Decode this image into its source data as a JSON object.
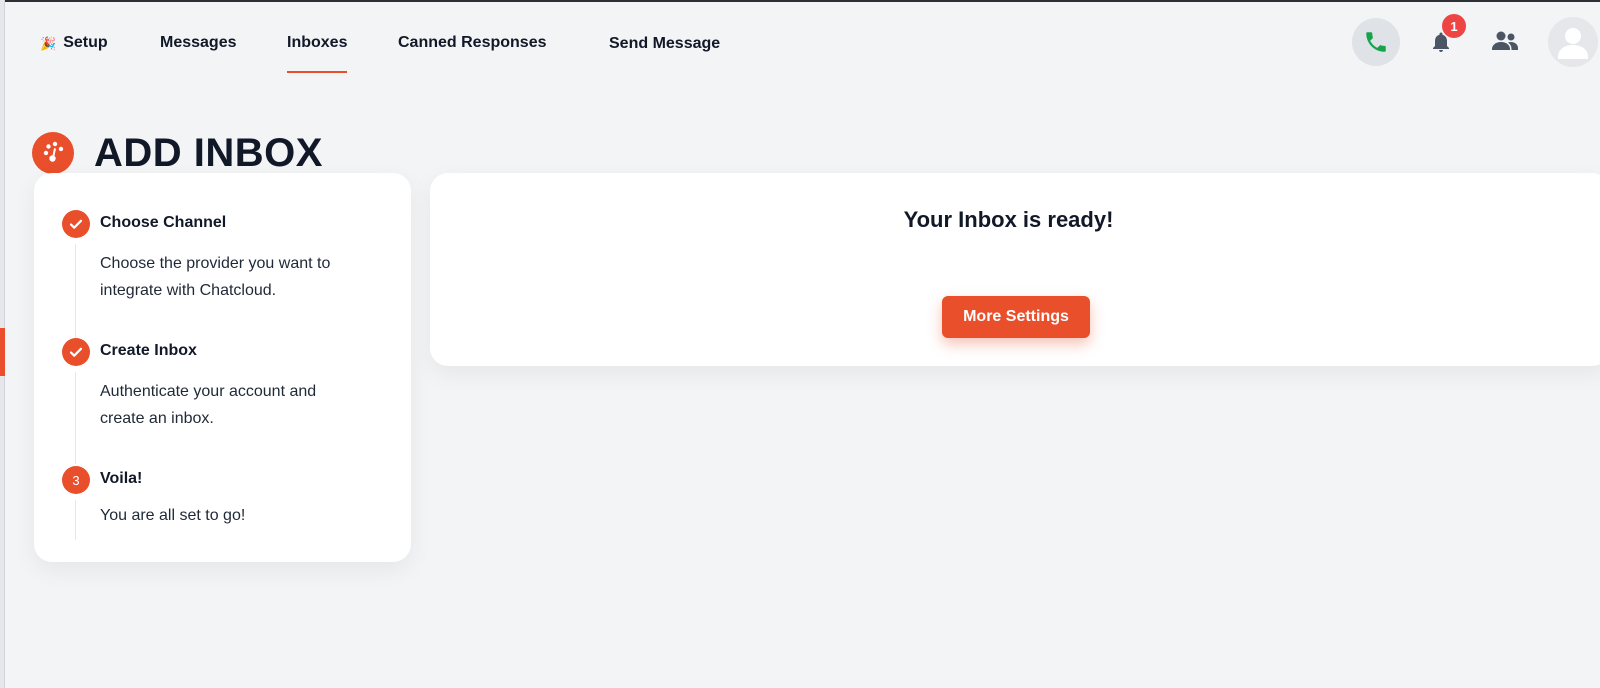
{
  "nav": {
    "setup": {
      "emoji": "🎉",
      "label": "Setup"
    },
    "messages": "Messages",
    "inboxes": "Inboxes",
    "canned_responses": "Canned Responses",
    "send_message": "Send Message",
    "active": "Inboxes"
  },
  "header_icons": {
    "phone": "phone-icon",
    "notifications": {
      "icon": "bell-icon",
      "count": "1"
    },
    "team": "users-icon",
    "account": "user-avatar-icon"
  },
  "page": {
    "title": "ADD INBOX",
    "title_icon": "dashboard-gauge-icon"
  },
  "steps": [
    {
      "status": "done",
      "marker": "",
      "title": "Choose Channel",
      "description": "Choose the provider you want to integrate with Chatcloud."
    },
    {
      "status": "done",
      "marker": "",
      "title": "Create Inbox",
      "description": "Authenticate your account and create an inbox."
    },
    {
      "status": "current",
      "marker": "3",
      "title": "Voila!",
      "description": "You are all set to go!"
    }
  ],
  "result": {
    "title": "Your Inbox is ready!",
    "button_label": "More Settings"
  },
  "colors": {
    "accent": "#e84f2a",
    "background": "#f3f4f6",
    "phone_green": "#16a34a",
    "badge_red": "#ef4444",
    "icon_gray": "#4b5563"
  }
}
